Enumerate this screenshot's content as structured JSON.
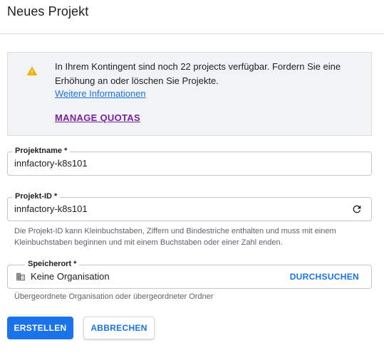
{
  "dialog": {
    "title": "Neues Projekt"
  },
  "notice": {
    "icon": "warning-icon",
    "text": "In Ihrem Kontingent sind noch 22 projects verfügbar. Fordern Sie eine Erhöhung an oder löschen Sie Projekte.",
    "link": "Weitere Informationen",
    "action": "MANAGE QUOTAS"
  },
  "project_name": {
    "label": "Projektname *",
    "value": "innfactory-k8s101"
  },
  "project_id": {
    "label": "Projekt-ID *",
    "value": "innfactory-k8s101",
    "icon": "refresh-icon",
    "hint": "Die Projekt-ID kann Kleinbuchstaben, Ziffern und Bindestriche enthalten und muss mit einem Kleinbuchstaben beginnen und mit einem Buchstaben oder einer Zahl enden."
  },
  "location": {
    "label": "Speicherort *",
    "icon": "organization-icon",
    "value": "Keine Organisation",
    "browse": "DURCHSUCHEN",
    "hint": "Übergeordnete Organisation oder übergeordneter Ordner"
  },
  "actions": {
    "create": "ERSTELLEN",
    "cancel": "ABBRECHEN"
  },
  "colors": {
    "primary": "#1a73e8",
    "warning": "#f9ab00",
    "quota_link": "#7b1fa2",
    "notice_bg": "#f1f3f4"
  }
}
